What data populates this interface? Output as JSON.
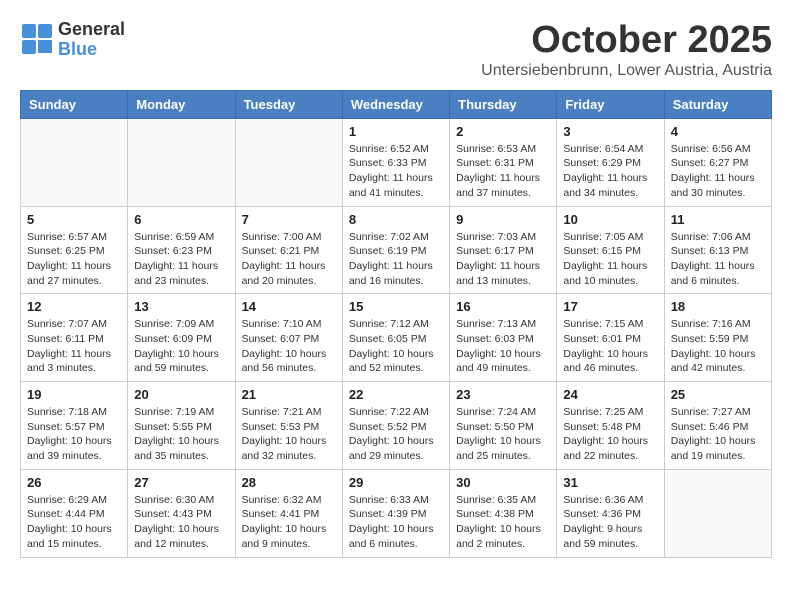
{
  "logo": {
    "line1": "General",
    "line2": "Blue"
  },
  "title": "October 2025",
  "location": "Untersiebenbrunn, Lower Austria, Austria",
  "days_of_week": [
    "Sunday",
    "Monday",
    "Tuesday",
    "Wednesday",
    "Thursday",
    "Friday",
    "Saturday"
  ],
  "weeks": [
    [
      {
        "day": "",
        "info": ""
      },
      {
        "day": "",
        "info": ""
      },
      {
        "day": "",
        "info": ""
      },
      {
        "day": "1",
        "info": "Sunrise: 6:52 AM\nSunset: 6:33 PM\nDaylight: 11 hours\nand 41 minutes."
      },
      {
        "day": "2",
        "info": "Sunrise: 6:53 AM\nSunset: 6:31 PM\nDaylight: 11 hours\nand 37 minutes."
      },
      {
        "day": "3",
        "info": "Sunrise: 6:54 AM\nSunset: 6:29 PM\nDaylight: 11 hours\nand 34 minutes."
      },
      {
        "day": "4",
        "info": "Sunrise: 6:56 AM\nSunset: 6:27 PM\nDaylight: 11 hours\nand 30 minutes."
      }
    ],
    [
      {
        "day": "5",
        "info": "Sunrise: 6:57 AM\nSunset: 6:25 PM\nDaylight: 11 hours\nand 27 minutes."
      },
      {
        "day": "6",
        "info": "Sunrise: 6:59 AM\nSunset: 6:23 PM\nDaylight: 11 hours\nand 23 minutes."
      },
      {
        "day": "7",
        "info": "Sunrise: 7:00 AM\nSunset: 6:21 PM\nDaylight: 11 hours\nand 20 minutes."
      },
      {
        "day": "8",
        "info": "Sunrise: 7:02 AM\nSunset: 6:19 PM\nDaylight: 11 hours\nand 16 minutes."
      },
      {
        "day": "9",
        "info": "Sunrise: 7:03 AM\nSunset: 6:17 PM\nDaylight: 11 hours\nand 13 minutes."
      },
      {
        "day": "10",
        "info": "Sunrise: 7:05 AM\nSunset: 6:15 PM\nDaylight: 11 hours\nand 10 minutes."
      },
      {
        "day": "11",
        "info": "Sunrise: 7:06 AM\nSunset: 6:13 PM\nDaylight: 11 hours\nand 6 minutes."
      }
    ],
    [
      {
        "day": "12",
        "info": "Sunrise: 7:07 AM\nSunset: 6:11 PM\nDaylight: 11 hours\nand 3 minutes."
      },
      {
        "day": "13",
        "info": "Sunrise: 7:09 AM\nSunset: 6:09 PM\nDaylight: 10 hours\nand 59 minutes."
      },
      {
        "day": "14",
        "info": "Sunrise: 7:10 AM\nSunset: 6:07 PM\nDaylight: 10 hours\nand 56 minutes."
      },
      {
        "day": "15",
        "info": "Sunrise: 7:12 AM\nSunset: 6:05 PM\nDaylight: 10 hours\nand 52 minutes."
      },
      {
        "day": "16",
        "info": "Sunrise: 7:13 AM\nSunset: 6:03 PM\nDaylight: 10 hours\nand 49 minutes."
      },
      {
        "day": "17",
        "info": "Sunrise: 7:15 AM\nSunset: 6:01 PM\nDaylight: 10 hours\nand 46 minutes."
      },
      {
        "day": "18",
        "info": "Sunrise: 7:16 AM\nSunset: 5:59 PM\nDaylight: 10 hours\nand 42 minutes."
      }
    ],
    [
      {
        "day": "19",
        "info": "Sunrise: 7:18 AM\nSunset: 5:57 PM\nDaylight: 10 hours\nand 39 minutes."
      },
      {
        "day": "20",
        "info": "Sunrise: 7:19 AM\nSunset: 5:55 PM\nDaylight: 10 hours\nand 35 minutes."
      },
      {
        "day": "21",
        "info": "Sunrise: 7:21 AM\nSunset: 5:53 PM\nDaylight: 10 hours\nand 32 minutes."
      },
      {
        "day": "22",
        "info": "Sunrise: 7:22 AM\nSunset: 5:52 PM\nDaylight: 10 hours\nand 29 minutes."
      },
      {
        "day": "23",
        "info": "Sunrise: 7:24 AM\nSunset: 5:50 PM\nDaylight: 10 hours\nand 25 minutes."
      },
      {
        "day": "24",
        "info": "Sunrise: 7:25 AM\nSunset: 5:48 PM\nDaylight: 10 hours\nand 22 minutes."
      },
      {
        "day": "25",
        "info": "Sunrise: 7:27 AM\nSunset: 5:46 PM\nDaylight: 10 hours\nand 19 minutes."
      }
    ],
    [
      {
        "day": "26",
        "info": "Sunrise: 6:29 AM\nSunset: 4:44 PM\nDaylight: 10 hours\nand 15 minutes."
      },
      {
        "day": "27",
        "info": "Sunrise: 6:30 AM\nSunset: 4:43 PM\nDaylight: 10 hours\nand 12 minutes."
      },
      {
        "day": "28",
        "info": "Sunrise: 6:32 AM\nSunset: 4:41 PM\nDaylight: 10 hours\nand 9 minutes."
      },
      {
        "day": "29",
        "info": "Sunrise: 6:33 AM\nSunset: 4:39 PM\nDaylight: 10 hours\nand 6 minutes."
      },
      {
        "day": "30",
        "info": "Sunrise: 6:35 AM\nSunset: 4:38 PM\nDaylight: 10 hours\nand 2 minutes."
      },
      {
        "day": "31",
        "info": "Sunrise: 6:36 AM\nSunset: 4:36 PM\nDaylight: 9 hours\nand 59 minutes."
      },
      {
        "day": "",
        "info": ""
      }
    ]
  ]
}
